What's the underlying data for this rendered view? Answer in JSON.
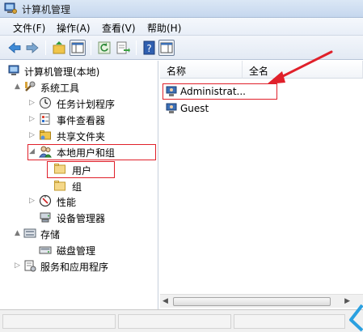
{
  "window": {
    "title": "计算机管理"
  },
  "menu": [
    "文件(F)",
    "操作(A)",
    "查看(V)",
    "帮助(H)"
  ],
  "tree": [
    {
      "label": "计算机管理(本地)",
      "icon": "computer-management-icon",
      "depth": 0,
      "arrow": ""
    },
    {
      "label": "系统工具",
      "icon": "system-tools-icon",
      "depth": 1,
      "arrow": "▲"
    },
    {
      "label": "任务计划程序",
      "icon": "task-scheduler-icon",
      "depth": 2,
      "arrow": "▷"
    },
    {
      "label": "事件查看器",
      "icon": "event-viewer-icon",
      "depth": 2,
      "arrow": "▷"
    },
    {
      "label": "共享文件夹",
      "icon": "shared-folders-icon",
      "depth": 2,
      "arrow": "▷"
    },
    {
      "label": "本地用户和组",
      "icon": "local-users-groups-icon",
      "depth": 2,
      "arrow": "◢"
    },
    {
      "label": "用户",
      "icon": "folder-icon",
      "depth": 3,
      "arrow": ""
    },
    {
      "label": "组",
      "icon": "folder-icon",
      "depth": 3,
      "arrow": ""
    },
    {
      "label": "性能",
      "icon": "performance-icon",
      "depth": 2,
      "arrow": "▷"
    },
    {
      "label": "设备管理器",
      "icon": "device-manager-icon",
      "depth": 2,
      "arrow": ""
    },
    {
      "label": "存储",
      "icon": "storage-icon",
      "depth": 1,
      "arrow": "▲"
    },
    {
      "label": "磁盘管理",
      "icon": "disk-management-icon",
      "depth": 2,
      "arrow": ""
    },
    {
      "label": "服务和应用程序",
      "icon": "services-apps-icon",
      "depth": 1,
      "arrow": "▷"
    }
  ],
  "list": {
    "columns": [
      "名称",
      "全名"
    ],
    "rows": [
      {
        "name": "Administrat...",
        "fullname": ""
      },
      {
        "name": "Guest",
        "fullname": ""
      }
    ]
  },
  "colors": {
    "annotation_red": "#e0202a",
    "selection_blue": "#cce8ff"
  }
}
